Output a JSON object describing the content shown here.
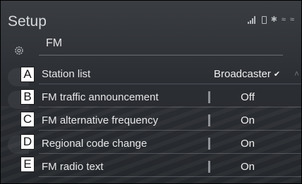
{
  "header": {
    "title": "Setup"
  },
  "status_icons": [
    "signal-icon",
    "battery-icon",
    "bluetooth-icon",
    "wifi-icon",
    "wifi-icon"
  ],
  "sub_header": {
    "label": "FM"
  },
  "rows": [
    {
      "callout": "A",
      "label": "Station list",
      "value": "Broadcaster",
      "type": "dropdown"
    },
    {
      "callout": "B",
      "label": "FM traffic announcement",
      "value": "Off",
      "type": "toggle"
    },
    {
      "callout": "C",
      "label": "FM alternative frequency",
      "value": "On",
      "type": "toggle"
    },
    {
      "callout": "D",
      "label": "Regional code change",
      "value": "On",
      "type": "toggle"
    },
    {
      "callout": "E",
      "label": "FM radio text",
      "value": "On",
      "type": "toggle"
    }
  ],
  "colors": {
    "background": "#2b2e33",
    "text": "#e6e7e8",
    "divider": "#8d9095"
  }
}
